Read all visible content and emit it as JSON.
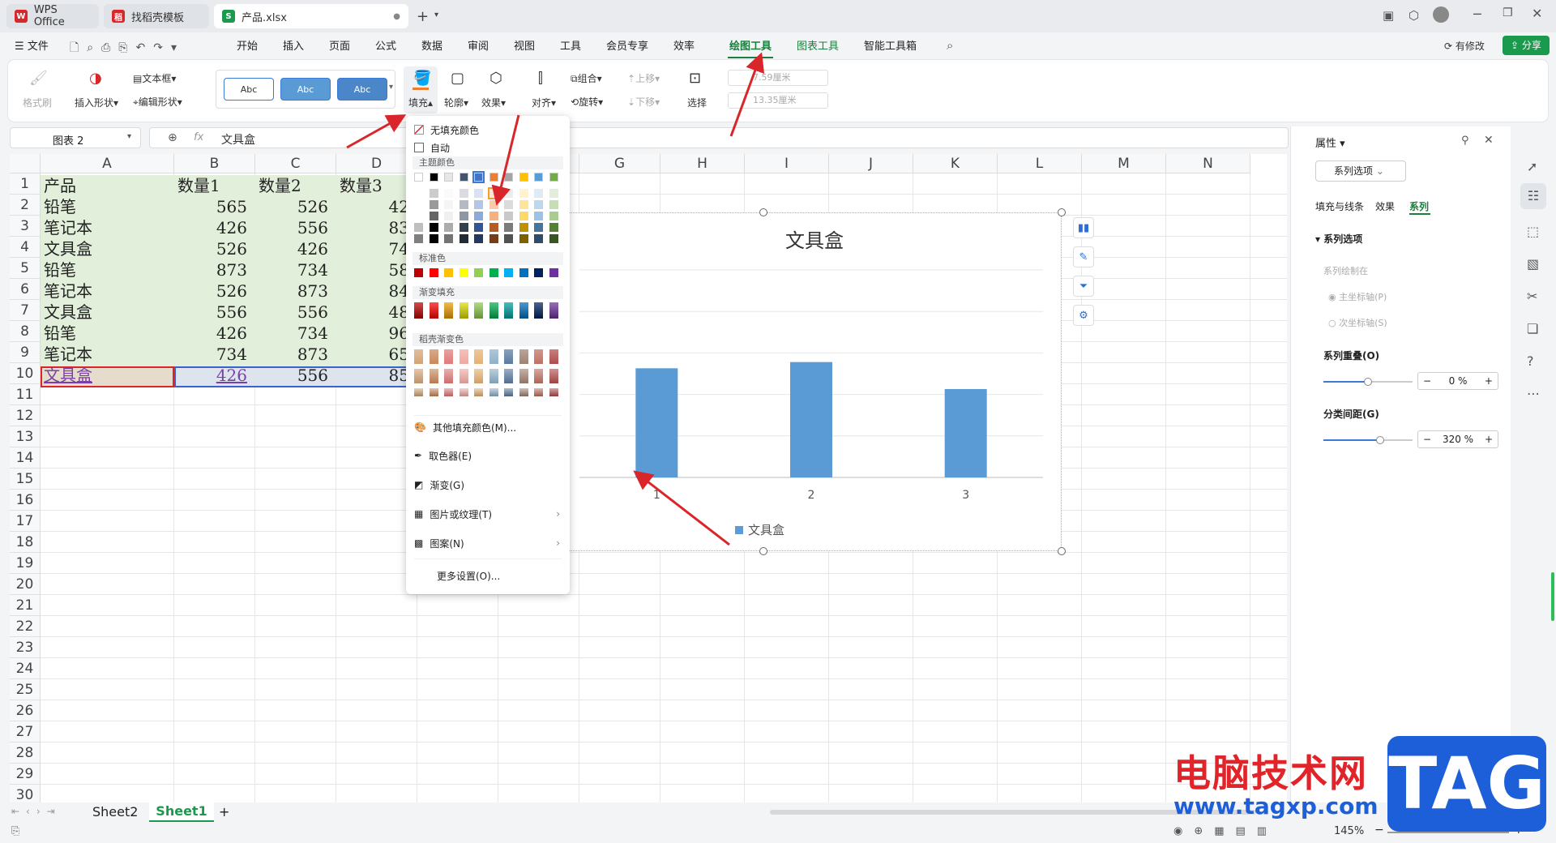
{
  "tabs": [
    {
      "label": "WPS Office",
      "logo": "W",
      "color": "#d9262a"
    },
    {
      "label": "找稻壳模板",
      "logo": "稻",
      "color": "#d9262a"
    },
    {
      "label": "产品.xlsx",
      "logo": "S",
      "color": "#1a9a4c"
    }
  ],
  "menu": {
    "file": "文件",
    "items": [
      "开始",
      "插入",
      "页面",
      "公式",
      "数据",
      "审阅",
      "视图",
      "工具",
      "会员专享",
      "效率",
      "绘图工具",
      "图表工具",
      "智能工具箱"
    ],
    "active": "绘图工具",
    "modified": "有修改",
    "share": "分享"
  },
  "ribbon": {
    "format_painter": "格式刷",
    "insert_shape": "插入形状",
    "textbox": "文本框",
    "edit_shape": "编辑形状",
    "style_sample": "Abc",
    "fill": "填充",
    "outline": "轮廓",
    "effect": "效果",
    "align": "对齐",
    "group": "组合",
    "rotate": "旋转",
    "bring_forward": "上移",
    "send_backward": "下移",
    "select": "选择",
    "width": "7.59厘米",
    "height": "13.35厘米"
  },
  "formula": {
    "name_box": "图表 2",
    "fx": "fx",
    "content": "文具盒"
  },
  "columns": [
    "A",
    "B",
    "C",
    "D",
    "E",
    "F",
    "G",
    "H",
    "I",
    "J",
    "K",
    "L",
    "M",
    "N"
  ],
  "rows": [
    "1",
    "2",
    "3",
    "4",
    "5",
    "6",
    "7",
    "8",
    "9",
    "10",
    "11",
    "12",
    "13",
    "14",
    "15",
    "16",
    "17",
    "18",
    "19",
    "20",
    "21",
    "22",
    "23",
    "24",
    "25",
    "26",
    "27",
    "28",
    "29",
    "30"
  ],
  "table": {
    "header": [
      "产品",
      "数量1",
      "数量2",
      "数量3"
    ],
    "data": [
      [
        "铅笔",
        "565",
        "526",
        "42"
      ],
      [
        "笔记本",
        "426",
        "556",
        "83"
      ],
      [
        "文具盒",
        "526",
        "426",
        "74"
      ],
      [
        "铅笔",
        "873",
        "734",
        "58"
      ],
      [
        "笔记本",
        "526",
        "873",
        "84"
      ],
      [
        "文具盒",
        "556",
        "556",
        "48"
      ],
      [
        "铅笔",
        "426",
        "734",
        "96"
      ],
      [
        "笔记本",
        "734",
        "873",
        "65"
      ],
      [
        "文具盒",
        "426",
        "556",
        "85"
      ]
    ]
  },
  "dropdown": {
    "no_fill": "无填充颜色",
    "auto": "自动",
    "theme_colors": "主题颜色",
    "standard_colors": "标准色",
    "gradient_fill": "渐变填充",
    "docer_gradient": "稻壳渐变色",
    "more_colors": "其他填充颜色(M)...",
    "eyedropper": "取色器(E)",
    "gradient": "渐变(G)",
    "picture_texture": "图片或纹理(T)",
    "pattern": "图案(N)",
    "more_settings": "更多设置(O)...",
    "theme_top": [
      "#ffffff",
      "#000000",
      "#e7e6e6",
      "#44546a",
      "#4472c4",
      "#ed7d31",
      "#a5a5a5",
      "#ffc000",
      "#5b9bd5",
      "#70ad47"
    ],
    "standard": [
      "#c00000",
      "#ff0000",
      "#ffc000",
      "#ffff00",
      "#92d050",
      "#00b050",
      "#00b0f0",
      "#0070c0",
      "#002060",
      "#7030a0"
    ],
    "gradients": [
      "#c00000",
      "#ff0000",
      "#f0a000",
      "#e0e000",
      "#92d050",
      "#00b050",
      "#00a0a0",
      "#0070c0",
      "#002060",
      "#7030a0"
    ]
  },
  "chart_data": {
    "type": "bar",
    "title": "文具盒",
    "categories": [
      "1",
      "2",
      "3"
    ],
    "series": [
      {
        "name": "文具盒",
        "values": [
          526,
          556,
          426
        ],
        "color": "#5b9bd5"
      }
    ],
    "ylim": [
      0,
      1000
    ],
    "grid": true,
    "legend": "bottom"
  },
  "panel": {
    "title": "属性",
    "dropdown": "系列选项",
    "tabs": [
      "填充与线条",
      "效果",
      "系列"
    ],
    "active_tab": "系列",
    "section": "系列选项",
    "plot_on": "系列绘制在",
    "primary_axis": "主坐标轴(P)",
    "secondary_axis": "次坐标轴(S)",
    "overlap_label": "系列重叠(O)",
    "overlap_value": "0 %",
    "overlap_fraction": 0.5,
    "gap_label": "分类间距(G)",
    "gap_value": "320 %",
    "gap_fraction": 0.64
  },
  "sheets": [
    "Sheet2",
    "Sheet1"
  ],
  "active_sheet": "Sheet1",
  "zoom": "145%",
  "watermark": {
    "text": "电脑技术网",
    "url": "www.tagxp.com",
    "tag": "TAG"
  }
}
